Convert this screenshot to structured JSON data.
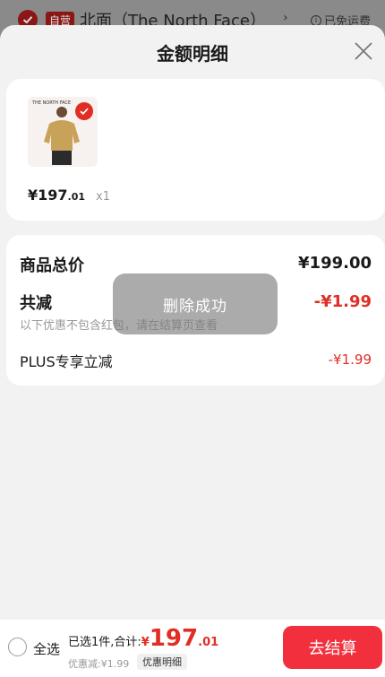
{
  "background": {
    "store_badge": "自营",
    "store_name": "北面（The North Face）",
    "chevron": "›",
    "shipping_icon": "i",
    "shipping_text": "已免运费"
  },
  "sheet": {
    "title": "金额明细",
    "close_icon": "close-icon"
  },
  "product": {
    "thumb_logo": "THE NORTH FACE",
    "price_int": "¥197",
    "price_dec": ".01",
    "quantity": "x1",
    "selected": true
  },
  "summary": {
    "total_label": "商品总价",
    "total_value": "¥199.00",
    "reduce_label": "共减",
    "reduce_value": "-¥1.99",
    "reduce_note": "以下优惠不包含红包，请在结算页查看",
    "plus_label": "PLUS专享立减",
    "plus_value": "-¥1.99"
  },
  "toast": {
    "text": "删除成功"
  },
  "bottom_bar": {
    "select_all": "全选",
    "selected_text": "已选1件,合计:",
    "total_currency": "¥",
    "total_int": "197",
    "total_dec": ".01",
    "discount_text": "优惠减:¥1.99",
    "detail_button": "优惠明细",
    "checkout_button": "去结算"
  },
  "colors": {
    "accent_red": "#e02e24",
    "checkout_red": "#f2303d"
  }
}
